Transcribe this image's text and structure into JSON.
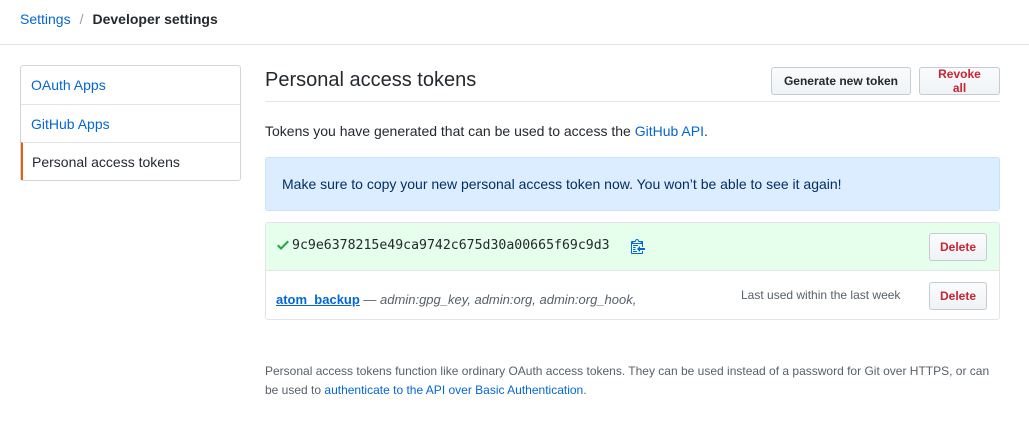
{
  "breadcrumb": {
    "root": "Settings",
    "separator": "/",
    "current": "Developer settings"
  },
  "sidebar": {
    "items": [
      {
        "label": "OAuth Apps"
      },
      {
        "label": "GitHub Apps"
      },
      {
        "label": "Personal access tokens"
      }
    ]
  },
  "header": {
    "title": "Personal access tokens",
    "generate_label": "Generate new token",
    "revoke_label": "Revoke all"
  },
  "lead": {
    "text": "Tokens you have generated that can be used to access the ",
    "link": "GitHub API",
    "suffix": "."
  },
  "flash": {
    "text": "Make sure to copy your new personal access token now. You won’t be able to see it again!"
  },
  "tokens": {
    "new_token": {
      "value": "9c9e6378215e49ca9742c675d30a00665f69c9d3",
      "delete_label": "Delete"
    },
    "existing": {
      "name": "atom_backup",
      "dash": " — ",
      "scopes": "admin:gpg_key, admin:org, admin:org_hook, admin:public_key, admin:repo_hook, delete_repo, gist, notifications, repo, user, write:discussion",
      "last_used": "Last used within the last week",
      "delete_label": "Delete"
    }
  },
  "note": {
    "text": "Personal access tokens function like ordinary OAuth access tokens. They can be used instead of a password for Git over HTTPS, or can be used to ",
    "link": "authenticate to the API over Basic Authentication",
    "suffix": "."
  },
  "colors": {
    "link": "#0366d6",
    "danger": "#cb2431",
    "flash_bg": "#dbedff",
    "success_bg": "#e6ffed",
    "selected_accent": "#e36209"
  },
  "icons": {
    "check": "check-icon",
    "copy": "clipboard-icon"
  }
}
